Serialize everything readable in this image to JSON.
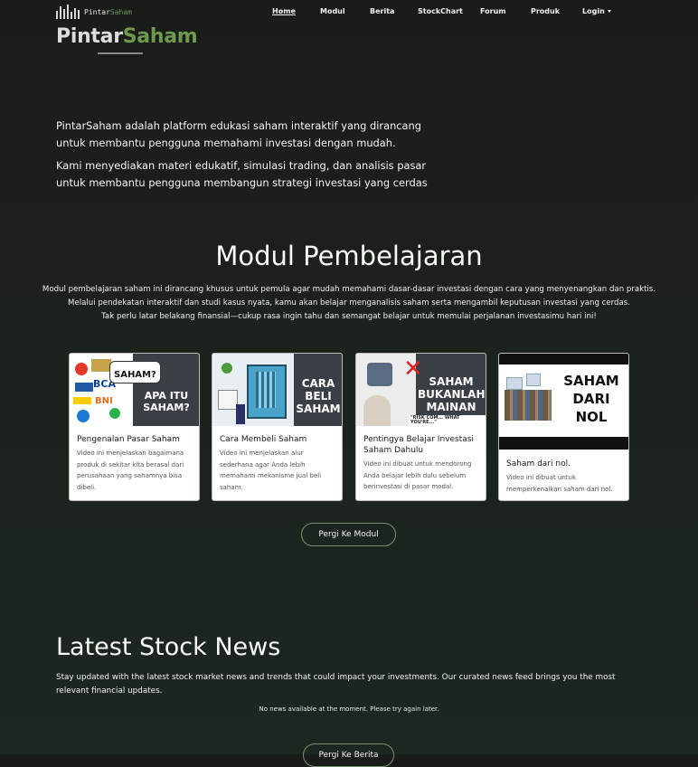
{
  "nav": {
    "brand_name_part1": "Pintar",
    "brand_name_part2": "Saham",
    "links": [
      "Home",
      "Modul",
      "Berita",
      "StockChart",
      "Forum",
      "Produk",
      "Login"
    ],
    "active": "Home"
  },
  "hero": {
    "logo_part1": "Pintar",
    "logo_part2": "Saham",
    "paragraph1": "PintarSaham adalah platform edukasi saham interaktif yang dirancang untuk membantu pengguna memahami investasi dengan mudah.",
    "paragraph2": "Kami menyediakan materi edukatif, simulasi trading, dan analisis pasar untuk membantu pengguna membangun strategi investasi yang cerdas"
  },
  "modul": {
    "title": "Modul Pembelajaran",
    "desc_line1": "Modul pembelajaran saham ini dirancang khusus untuk pemula agar mudah memahami dasar-dasar investasi dengan cara yang menyenangkan dan praktis.",
    "desc_line2": "Melalui pendekatan interaktif dan studi kasus nyata, kamu akan belajar menganalisis saham serta mengambil keputusan investasi yang cerdas.",
    "desc_line3": "Tak perlu latar belakang finansial—cukup rasa ingin tahu dan semangat belajar untuk memulai perjalanan investasimu hari ini!",
    "cards": [
      {
        "title": "Pengenalan Pasar Saham",
        "desc": "Video ini menjelaskan bagaimana produk di sekitar kita berasal dari perusahaan yang sahamnya bisa dibeli.",
        "thumb_text1": "SAHAM?",
        "thumb_text2": "APA ITU SAHAM?",
        "thumb_logo1": "BCA",
        "thumb_logo2": "BNI"
      },
      {
        "title": "Cara Membeli Saham",
        "desc": "Video ini menjelaskan alur sederhana agar Anda lebih memahami mekanisme jual beli saham.",
        "thumb_text": "CARA BELI SAHAM"
      },
      {
        "title": "Pentingya Belajar Investasi Saham Dahulu",
        "desc": "Video ini dibuat untuk mendorong Anda belajar lebih dulu sebelum berinvestasi di pasar modal.",
        "thumb_text": "SAHAM BUKANLAH MAINAN",
        "thumb_quote": "\"RISK COM... WHAT YOU'RE...\""
      },
      {
        "title": "Saham dari nol.",
        "desc": "Video ini dibuat untuk memperkenalkan saham dari nol.",
        "thumb_text": "SAHAM DARI NOL"
      }
    ],
    "button_label": "Pergi Ke Modul"
  },
  "news": {
    "title": "Latest Stock News",
    "desc": "Stay updated with the latest stock market news and trends that could impact your investments. Our curated news feed brings you the most relevant financial updates.",
    "empty_message": "No news available at the moment. Please try again later.",
    "button_label": "Pergi Ke Berita"
  },
  "colors": {
    "background": "#1b211b",
    "brand_accent": "#6e9a4e",
    "button_border": "#7a8f72",
    "card_bg": "#ffffff"
  }
}
